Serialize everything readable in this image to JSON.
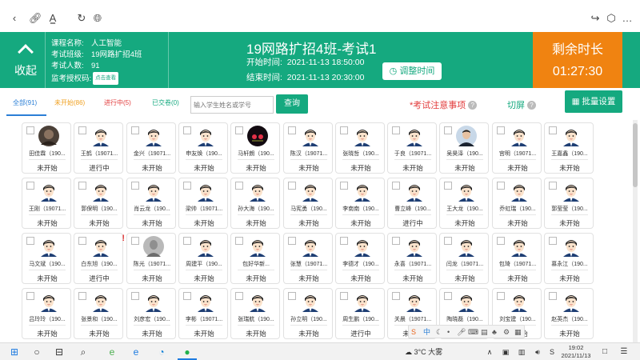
{
  "header": {
    "collapse_label": "收起",
    "course_info": [
      {
        "key": "课程名称:",
        "value": "人工智能"
      },
      {
        "key": "考试班级:",
        "value": "19网路扩招4班"
      },
      {
        "key": "考试人数:",
        "value": "91"
      }
    ],
    "auth_code_key": "监考授权码:",
    "auth_code_view": "点击查看",
    "exam_title": "19网路扩招4班-考试1",
    "start_label": "开始时间:",
    "start_time": "2021-11-13 18:50:00",
    "end_label": "结束时间:",
    "end_time": "2021-11-13 20:30:00",
    "adjust_time_label": "调整时间",
    "remaining_label": "剩余时长",
    "remaining_time": "01:27:30",
    "colors": {
      "green": "#15a97f",
      "orange": "#f08311"
    }
  },
  "filters": {
    "tabs": [
      {
        "label": "全部(91)",
        "color": "#2b7fd6"
      },
      {
        "label": "未开始(86)",
        "color": "#f0a020"
      },
      {
        "label": "进行中(5)",
        "color": "#e23c3c"
      },
      {
        "label": "已交卷(0)",
        "color": "#15a97f"
      }
    ],
    "search_placeholder": "输入学生姓名或学号",
    "search_button": "查询",
    "notice_label": "*考试注意事项",
    "split_label": "切屏",
    "batch_label": "批量设置"
  },
  "students": [
    {
      "name": "田佳霖（190...",
      "status": "未开始",
      "avatar": "photo-dark"
    },
    {
      "name": "王鹤（19071...",
      "status": "进行中",
      "avatar": "cartoon"
    },
    {
      "name": "金兴（19071...",
      "status": "未开始",
      "avatar": "cartoon"
    },
    {
      "name": "申友焕（190...",
      "status": "未开始",
      "avatar": "cartoon"
    },
    {
      "name": "马轩朗（190...",
      "status": "未开始",
      "avatar": "photo-car"
    },
    {
      "name": "陈汉（19071...",
      "status": "未开始",
      "avatar": "cartoon"
    },
    {
      "name": "张晓哲（190...",
      "status": "未开始",
      "avatar": "cartoon"
    },
    {
      "name": "于良（19071...",
      "status": "未开始",
      "avatar": "cartoon"
    },
    {
      "name": "吴昊泽（190...",
      "status": "未开始",
      "avatar": "photo-person"
    },
    {
      "name": "宫明（19071...",
      "status": "未开始",
      "avatar": "cartoon"
    },
    {
      "name": "王嘉鑫（190...",
      "status": "未开始",
      "avatar": "cartoon"
    },
    {
      "name": "王刚（19071...",
      "status": "未开始",
      "avatar": "cartoon"
    },
    {
      "name": "郭保明（190...",
      "status": "未开始",
      "avatar": "cartoon"
    },
    {
      "name": "肖云龙（190...",
      "status": "未开始",
      "avatar": "cartoon"
    },
    {
      "name": "梁帅（19071...",
      "status": "未开始",
      "avatar": "cartoon"
    },
    {
      "name": "孙大海（190...",
      "status": "未开始",
      "avatar": "cartoon"
    },
    {
      "name": "马宪勇（190...",
      "status": "未开始",
      "avatar": "cartoon"
    },
    {
      "name": "李南南（190...",
      "status": "未开始",
      "avatar": "cartoon"
    },
    {
      "name": "曹立峰（190...",
      "status": "进行中",
      "avatar": "cartoon"
    },
    {
      "name": "王大龙（190...",
      "status": "未开始",
      "avatar": "cartoon"
    },
    {
      "name": "乔虹瑞（190...",
      "status": "未开始",
      "avatar": "cartoon"
    },
    {
      "name": "郭莹莹（190...",
      "status": "未开始",
      "avatar": "cartoon"
    },
    {
      "name": "马文斌（190...",
      "status": "未开始",
      "avatar": "cartoon"
    },
    {
      "name": "白东旭（190...",
      "status": "进行中",
      "avatar": "cartoon",
      "flag": "!"
    },
    {
      "name": "陈光（19071...",
      "status": "未开始",
      "avatar": "photo-grey"
    },
    {
      "name": "周建平（190...",
      "status": "未开始",
      "avatar": "cartoon"
    },
    {
      "name": "包好华新...",
      "status": "未开始",
      "avatar": "cartoon"
    },
    {
      "name": "张慧（19071...",
      "status": "未开始",
      "avatar": "cartoon"
    },
    {
      "name": "李德才（190...",
      "status": "未开始",
      "avatar": "cartoon"
    },
    {
      "name": "永喜（19071...",
      "status": "未开始",
      "avatar": "cartoon"
    },
    {
      "name": "闫龙（19071...",
      "status": "未开始",
      "avatar": "cartoon"
    },
    {
      "name": "包琦（19071...",
      "status": "未开始",
      "avatar": "cartoon"
    },
    {
      "name": "慕永江（190...",
      "status": "未开始",
      "avatar": "cartoon"
    },
    {
      "name": "吕玲玲（190...",
      "status": "未开始",
      "avatar": "cartoon"
    },
    {
      "name": "张景和（190...",
      "status": "未开始",
      "avatar": "cartoon"
    },
    {
      "name": "刘彦宏（190...",
      "status": "未开始",
      "avatar": "cartoon"
    },
    {
      "name": "李彬（19071...",
      "status": "未开始",
      "avatar": "cartoon"
    },
    {
      "name": "张瑞航（190...",
      "status": "未开始",
      "avatar": "cartoon"
    },
    {
      "name": "孙立明（190...",
      "status": "未开始",
      "avatar": "cartoon"
    },
    {
      "name": "周生鹏（190...",
      "status": "进行中",
      "avatar": "cartoon"
    },
    {
      "name": "关晨（19071...",
      "status": "未开始",
      "avatar": "cartoon"
    },
    {
      "name": "陶晓磊（190...",
      "status": "未开始",
      "avatar": "cartoon"
    },
    {
      "name": "刘宝建（190...",
      "status": "未开始",
      "avatar": "cartoon"
    },
    {
      "name": "赵英杰（190...",
      "status": "未开始",
      "avatar": "cartoon"
    }
  ],
  "taskbar": {
    "weather": "3°C 大雾",
    "time": "19:02",
    "date": "2021/11/13",
    "ime_label": "中"
  }
}
